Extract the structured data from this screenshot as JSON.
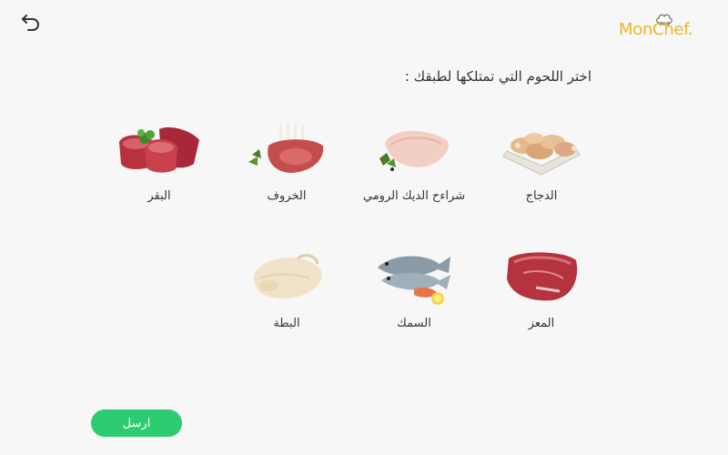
{
  "header": {
    "back_icon": "undo-arrow-icon",
    "logo_text": "MonChef.",
    "logo_icon": "chef-hat-icon",
    "logo_color": "#f0b429"
  },
  "prompt": "اختر اللحوم التي تمتلكها لطبقك :",
  "items": [
    {
      "label": "الدجاج",
      "icon": "chicken-tray-icon"
    },
    {
      "label": "شراءح الديك الرومي",
      "icon": "turkey-breast-icon"
    },
    {
      "label": "الخروف",
      "icon": "lamb-rack-icon"
    },
    {
      "label": "البقر",
      "icon": "beef-cuts-icon"
    },
    {
      "label": "المعز",
      "icon": "goat-meat-icon"
    },
    {
      "label": "السمك",
      "icon": "fish-icon"
    },
    {
      "label": "البطة",
      "icon": "duck-icon"
    }
  ],
  "send_button": {
    "label": "ارسل",
    "color": "#2ecc71"
  }
}
